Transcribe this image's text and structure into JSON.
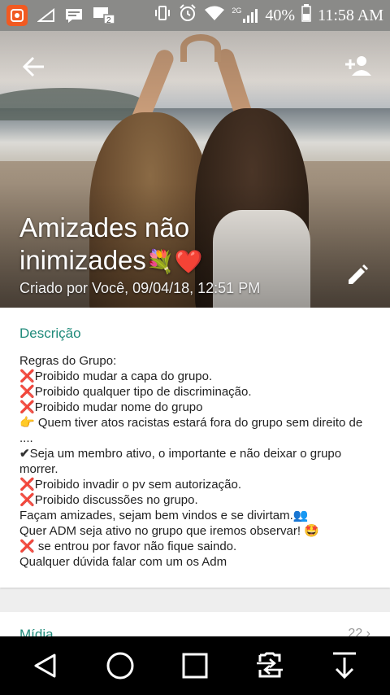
{
  "status_bar": {
    "battery": "40%",
    "time": "11:58 AM",
    "network": "2G",
    "notification_badge": "2",
    "icons": [
      "app-notification-icon",
      "signal-off-icon",
      "message-icon",
      "chat-icon",
      "vibrate-icon",
      "alarm-icon",
      "wifi-icon",
      "cell-signal-icon",
      "battery-icon"
    ]
  },
  "header": {
    "title_line1": "Amizades não",
    "title_line2": "inimizades",
    "title_emoji": "💐❤️",
    "created": "Criado por Você, 09/04/18, 12:51 PM",
    "back_icon": "arrow-left-icon",
    "add_icon": "person-add-icon",
    "edit_icon": "pencil-icon"
  },
  "description": {
    "heading": "Descrição",
    "lines": [
      {
        "mark": "",
        "text": "Regras do Grupo:"
      },
      {
        "mark": "❌",
        "text": "Proibido mudar a capa do grupo."
      },
      {
        "mark": "❌",
        "text": "Proibido qualquer tipo de discriminação."
      },
      {
        "mark": "❌",
        "text": "Proibido mudar nome do grupo"
      },
      {
        "mark": "👉",
        "text": " Quem tiver atos racistas estará fora do grupo sem direito de ...."
      },
      {
        "mark": "✔",
        "text": "Seja um membro ativo, o importante e não deixar o grupo morrer."
      },
      {
        "mark": "❌",
        "text": "Proibido invadir o pv sem autorização."
      },
      {
        "mark": "❌",
        "text": "Proibido discussões no grupo."
      },
      {
        "mark": "",
        "text": "Façam amizades, sejam bem vindos e se divirtam.👥"
      },
      {
        "mark": "",
        "text": "Quer ADM seja ativo no grupo que iremos observar! 🤩"
      },
      {
        "mark": "❌",
        "text": "  se entrou por favor não fique saindo."
      },
      {
        "mark": "",
        "text": "Qualquer dúvida falar com um os Adm"
      }
    ]
  },
  "media": {
    "label": "Mídia",
    "count": "22"
  },
  "nav_bar": {
    "buttons": [
      "back-triangle-icon",
      "home-circle-icon",
      "recents-square-icon",
      "switch-app-icon",
      "download-icon"
    ]
  }
}
